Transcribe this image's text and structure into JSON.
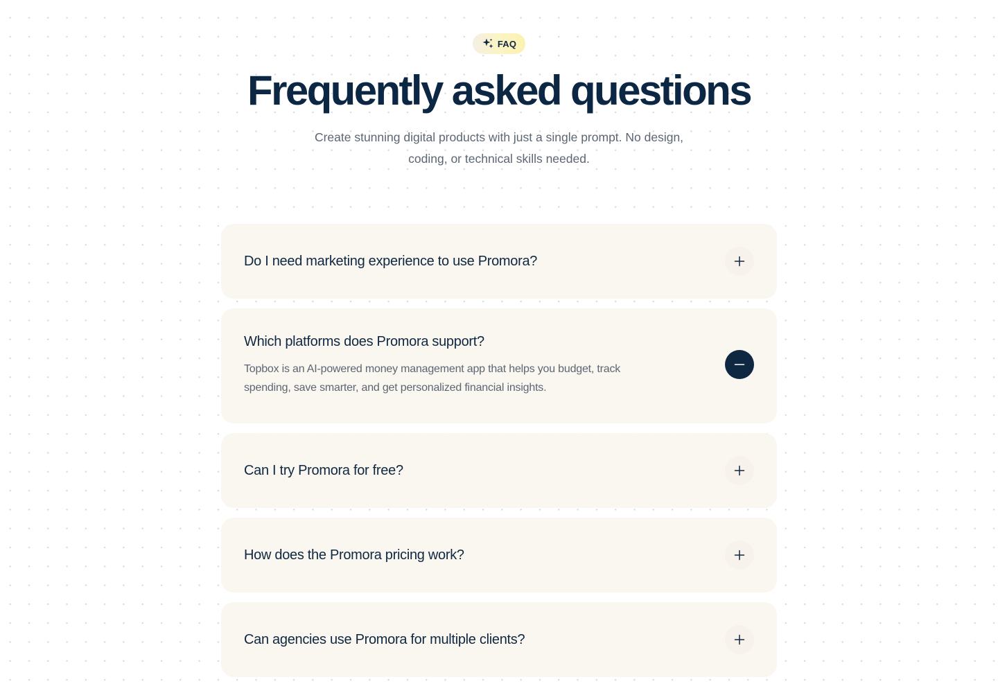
{
  "badge": {
    "label": "FAQ",
    "icon": "sparkle-icon"
  },
  "header": {
    "title": "Frequently asked questions",
    "subtitle": "Create stunning digital products with just a single prompt. No design, coding, or technical skills needed."
  },
  "faq": {
    "items": [
      {
        "question": "Do I need marketing experience to use Promora?",
        "expanded": false,
        "icon": "plus-icon"
      },
      {
        "question": "Which platforms does Promora support?",
        "answer": "Topbox is an AI-powered money management app that helps you budget, track spending, save smarter, and get personalized financial insights.",
        "expanded": true,
        "icon": "minus-icon"
      },
      {
        "question": "Can I try Promora for free?",
        "expanded": false,
        "icon": "plus-icon"
      },
      {
        "question": "How does the Promora pricing work?",
        "expanded": false,
        "icon": "plus-icon"
      },
      {
        "question": "Can agencies use Promora for multiple clients?",
        "expanded": false,
        "icon": "plus-icon"
      }
    ]
  },
  "colors": {
    "heading": "#0c2743",
    "body_text": "#5c6672",
    "card_background": "#faf6f0",
    "active_toggle": "#0f2842",
    "badge_gradient_end": "#fcf1b2"
  }
}
